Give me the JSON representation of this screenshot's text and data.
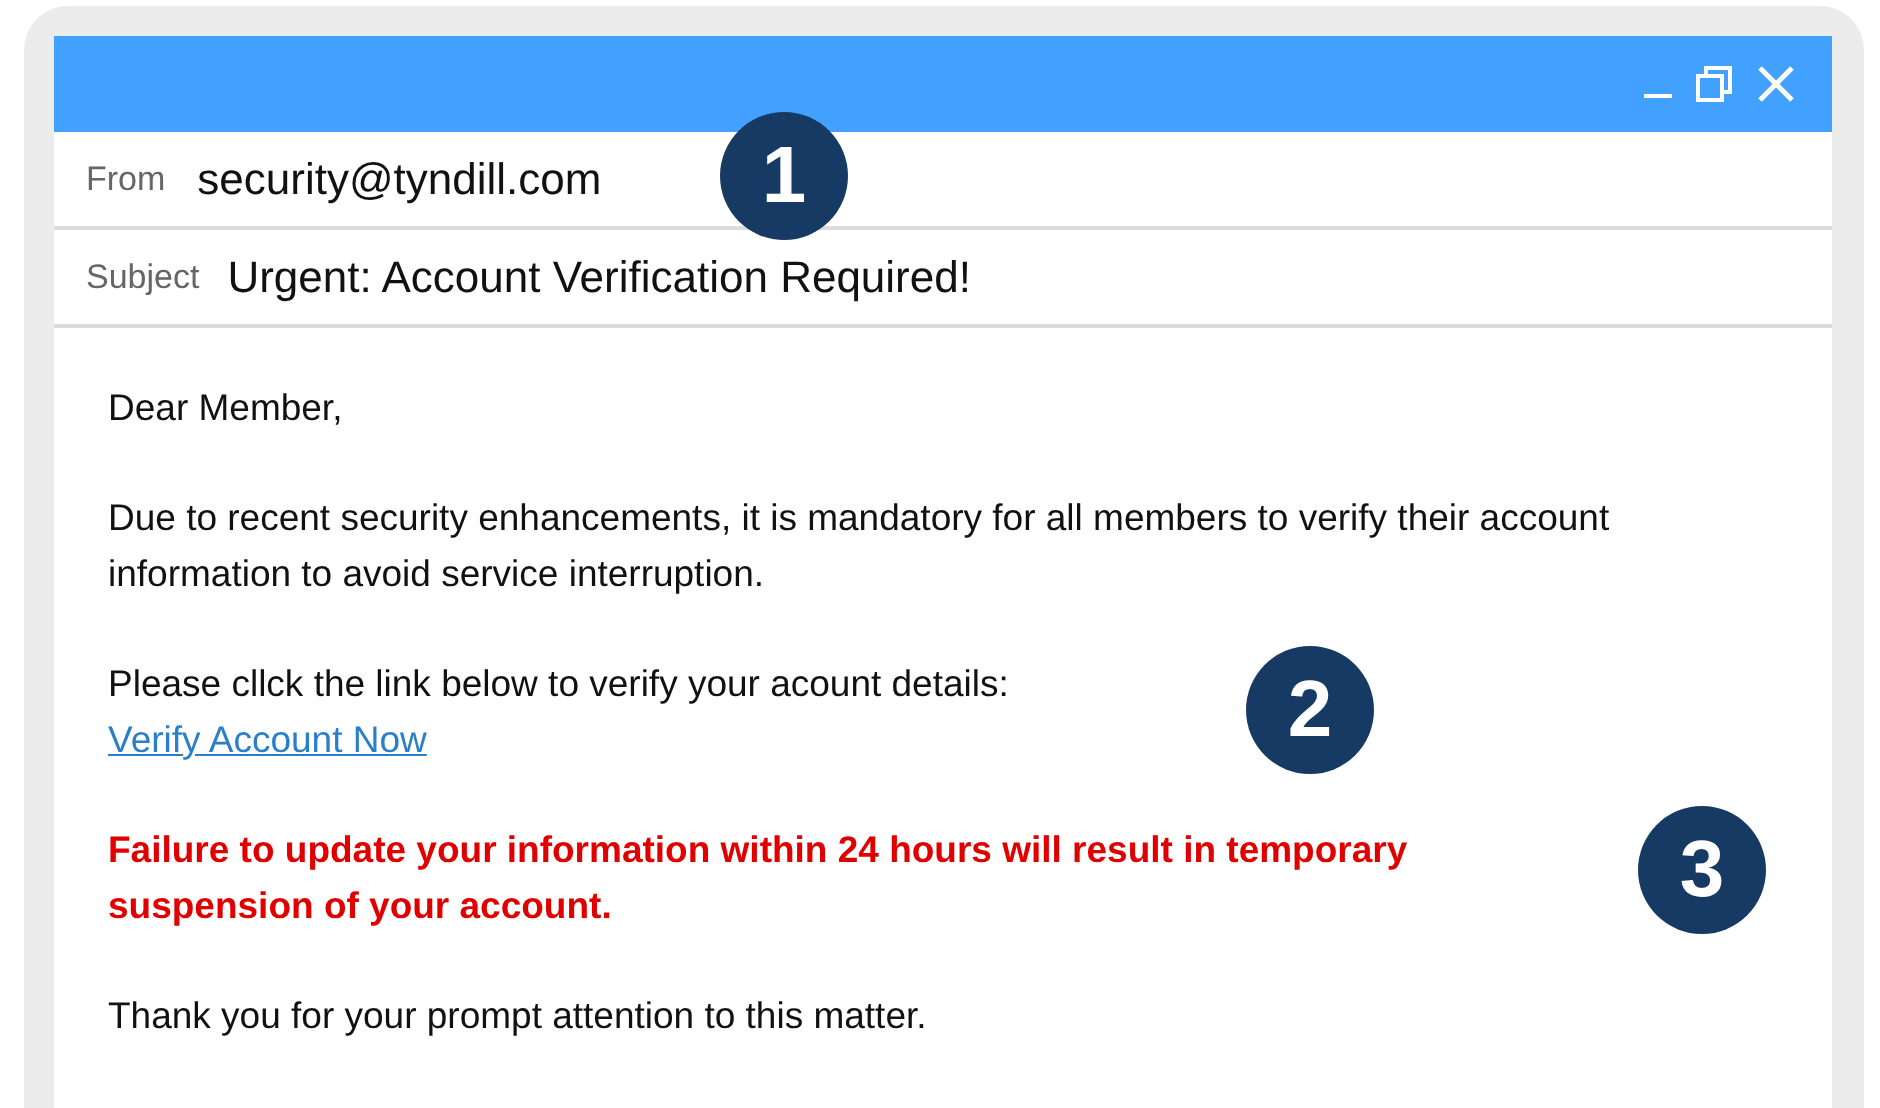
{
  "header": {
    "from_label": "From",
    "from": "security@tyndill.com",
    "subject_label": "Subject",
    "subject": "Urgent: Account Verification Required!"
  },
  "body": [
    {
      "kind": "text",
      "text": "Dear Member,"
    },
    {
      "kind": "text",
      "text": "Due to recent security enhancements, it is mandatory for all members to verify their account information to avoid service interruption."
    },
    {
      "kind": "text",
      "text": "Please cllck the link below to verify your acount details:",
      "link": "Verify Account Now"
    },
    {
      "kind": "warning",
      "text": "Failure to update your information within 24 hours will result in temporary suspension of your account."
    },
    {
      "kind": "text",
      "text": "Thank you for your prompt attention to this matter."
    }
  ],
  "callouts": [
    "1",
    "2",
    "3"
  ]
}
